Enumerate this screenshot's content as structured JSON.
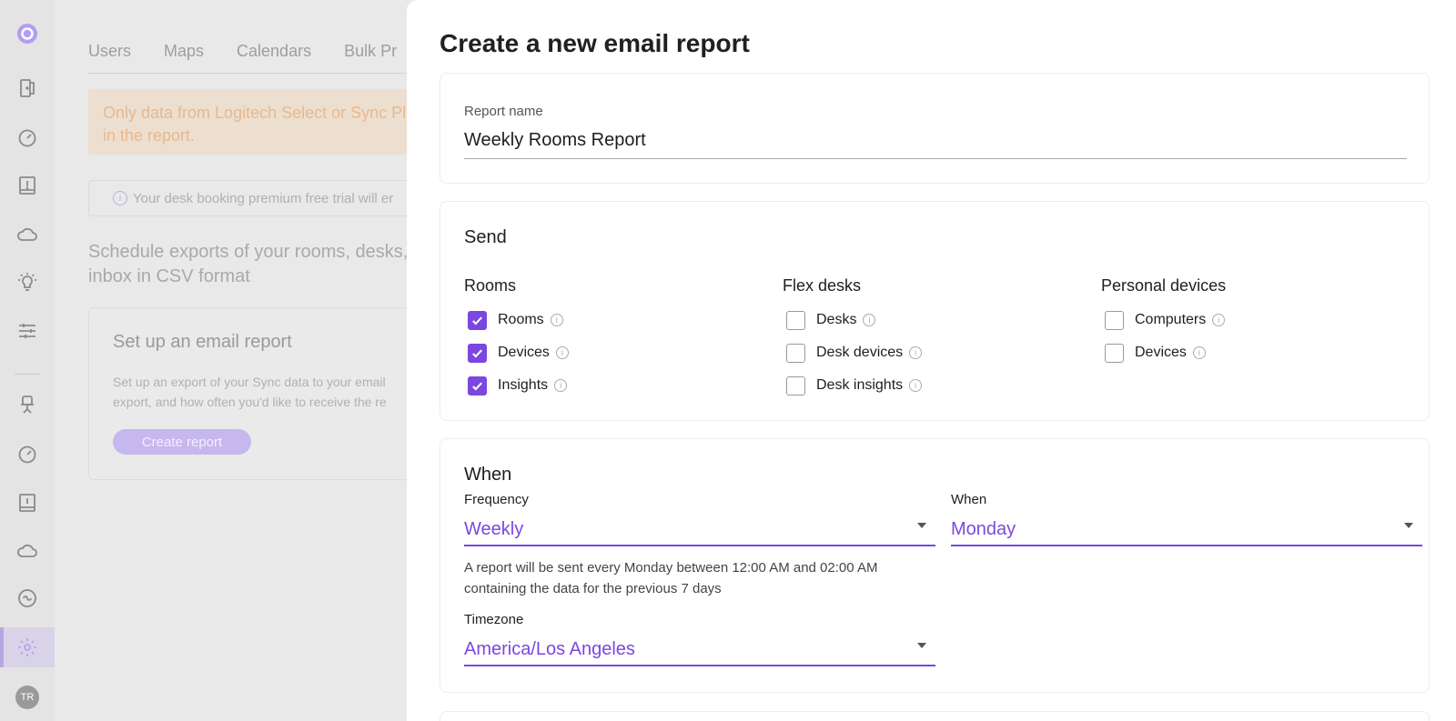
{
  "sidebar": {
    "icons": [
      "logo-icon",
      "door-icon",
      "gauge-icon",
      "alert-panel-icon",
      "cloud-icon",
      "lightbulb-icon",
      "sliders-icon",
      "desk-chair-icon",
      "gauge-icon",
      "alert-panel-icon",
      "cloud-icon",
      "sync-icon",
      "gear-icon"
    ],
    "avatar_initials": "TR",
    "accent": "#7b47e0"
  },
  "background_page": {
    "tabs": [
      "Users",
      "Maps",
      "Calendars",
      "Bulk Pr"
    ],
    "warning_line1": "Only data from Logitech Select or Sync Plu",
    "warning_line2": "in the report.",
    "trial_notice": "Your desk booking premium free trial will er",
    "schedule_line1": "Schedule exports of your rooms, desks, o",
    "schedule_line2": "inbox in CSV format",
    "setup_title": "Set up an email report",
    "setup_desc_line1": "Set up an export of your Sync data to your email",
    "setup_desc_line2": "export, and how often you'd like to receive the re",
    "create_button": "Create report"
  },
  "modal": {
    "title": "Create a new email report",
    "report_name_label": "Report name",
    "report_name_value": "Weekly Rooms Report",
    "send": {
      "title": "Send",
      "groups": [
        {
          "heading": "Rooms",
          "items": [
            {
              "label": "Rooms",
              "checked": true
            },
            {
              "label": "Devices",
              "checked": true
            },
            {
              "label": "Insights",
              "checked": true
            }
          ]
        },
        {
          "heading": "Flex desks",
          "items": [
            {
              "label": "Desks",
              "checked": false
            },
            {
              "label": "Desk devices",
              "checked": false
            },
            {
              "label": "Desk insights",
              "checked": false
            }
          ]
        },
        {
          "heading": "Personal devices",
          "items": [
            {
              "label": "Computers",
              "checked": false
            },
            {
              "label": "Devices",
              "checked": false
            }
          ]
        }
      ]
    },
    "when": {
      "title": "When",
      "frequency_label": "Frequency",
      "frequency_value": "Weekly",
      "day_label": "When",
      "day_value": "Monday",
      "hint_line1": "A report will be sent every Monday between 12:00 AM and 02:00 AM",
      "hint_line2": "containing the data for the previous 7 days",
      "timezone_label": "Timezone",
      "timezone_value": "America/Los Angeles"
    }
  }
}
